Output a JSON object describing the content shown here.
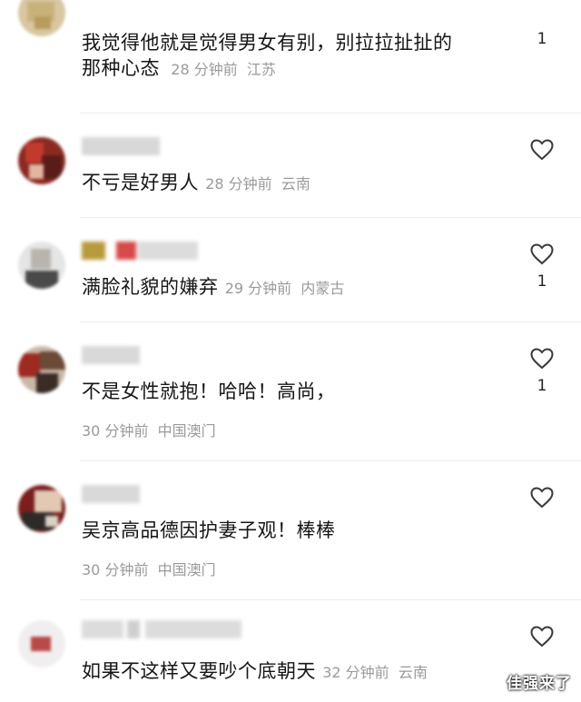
{
  "comments": [
    {
      "text": "我觉得他就是觉得男女有别，别拉拉扯扯的那种心态",
      "time": "28 分钟前",
      "location": "江苏",
      "likes": "1",
      "line1": "我觉得他就是觉得男女有别，别拉拉扯扯的",
      "line2": "那种心态"
    },
    {
      "text": "不亏是好男人",
      "time": "28 分钟前",
      "location": "云南",
      "likes": ""
    },
    {
      "text": "满脸礼貌的嫌弃",
      "time": "29 分钟前",
      "location": "内蒙古",
      "likes": "1"
    },
    {
      "text": "不是女性就抱！哈哈！高尚，",
      "time": "30 分钟前",
      "location": "中国澳门",
      "likes": "1"
    },
    {
      "text": "吴京高品德因护妻子观！棒棒",
      "time": "30 分钟前",
      "location": "中国澳门",
      "likes": ""
    },
    {
      "text": "如果不这样又要吵个底朝天",
      "time": "32 分钟前",
      "location": "云南",
      "likes": ""
    }
  ],
  "watermark": "佳强来了",
  "icons": {
    "like": "heart-icon"
  },
  "colors": {
    "meta": "#9a9a9a",
    "divider": "#ececec"
  }
}
